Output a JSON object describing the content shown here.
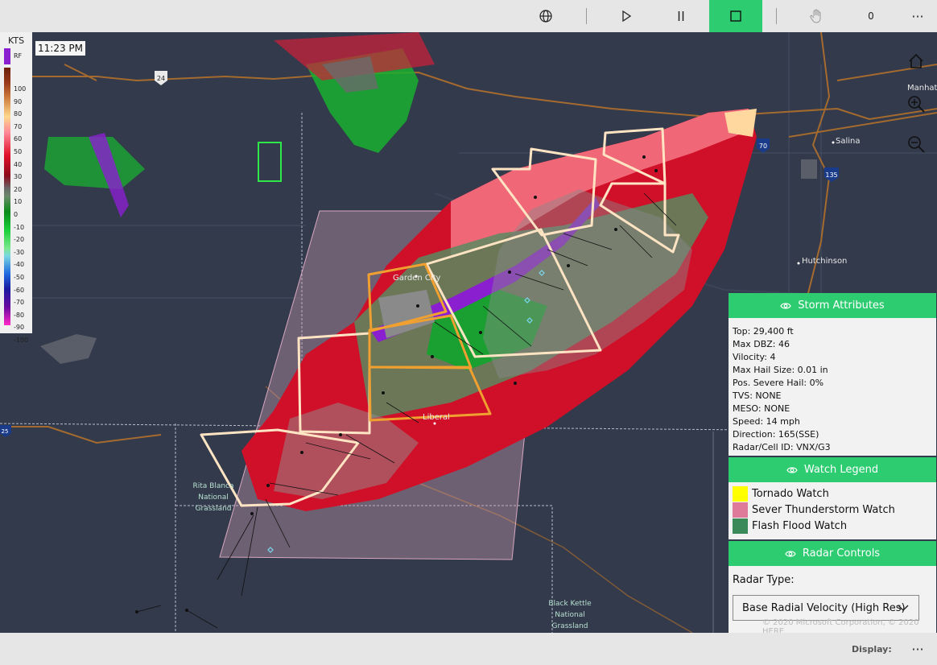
{
  "toolbar": {
    "globe_icon": "globe-icon",
    "play_icon": "play-icon",
    "pause_icon": "pause-icon",
    "stop_icon": "stop-icon",
    "hand_icon": "hand-icon",
    "hand_count": "0",
    "more_label": "···",
    "accent_color": "#2ecc71"
  },
  "scale": {
    "unit": "KTS",
    "rf_label": "RF",
    "ticks": [
      "100",
      "90",
      "80",
      "70",
      "60",
      "50",
      "40",
      "30",
      "20",
      "10",
      "0",
      "-10",
      "-20",
      "-30",
      "-40",
      "-50",
      "-60",
      "-70",
      "-80",
      "-90",
      "-100"
    ]
  },
  "time": "11:23 PM",
  "map_labels": {
    "garden_city": "Garden City",
    "liberal": "Liberal",
    "salina": "Salina",
    "hutchinson": "Hutchinson",
    "manhattan": "Manhat",
    "rita_blanca_1": "Rita Blanca",
    "rita_blanca_2": "National",
    "rita_blanca_3": "Grassland",
    "black_kettle_1": "Black Kettle",
    "black_kettle_2": "National",
    "black_kettle_3": "Grassland",
    "hwy_70_a": "70",
    "hwy_70_b": "70",
    "hwy_24": "24",
    "hwy_135": "135",
    "hwy_25": "25"
  },
  "storm_attributes": {
    "title": "Storm Attributes",
    "top": "Top: 29,400 ft",
    "max_dbz": "Max DBZ: 46",
    "velocity": "Vilocity: 4",
    "max_hail": "Max Hail Size: 0.01 in",
    "pos_severe_hail": "Pos. Severe Hail: 0%",
    "tvs": "TVS: NONE",
    "meso": "MESO: NONE",
    "speed": "Speed: 14 mph",
    "direction": "Direction: 165(SSE)",
    "radar_cell": "Radar/Cell ID: VNX/G3"
  },
  "watch_legend": {
    "title": "Watch Legend",
    "items": [
      {
        "label": "Tornado Watch",
        "color": "#ffff00"
      },
      {
        "label": "Sever Thunderstorm Watch",
        "color": "#e07a9a"
      },
      {
        "label": "Flash Flood Watch",
        "color": "#3a8a5a"
      }
    ]
  },
  "radar_controls": {
    "title": "Radar Controls",
    "type_label": "Radar Type:",
    "selected": "Base Radial Velocity (High Res)"
  },
  "copyright": "© 2020 Microsoft Corporation, © 2020 HERE",
  "bottom": {
    "display_label": "Display:",
    "more_label": "···"
  }
}
